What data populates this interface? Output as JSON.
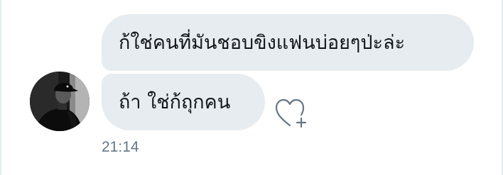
{
  "messages": [
    {
      "text": "ก้ใช่คนที่มันชอบขิงแฟนบ่อยๆป่ะล่ะ"
    },
    {
      "text": "ถ้า ใช่ก้ถุกคน"
    }
  ],
  "timestamp": "21:14",
  "colors": {
    "bubble_background": "#e6ecf0",
    "text": "#14171a",
    "secondary_text": "#657786"
  },
  "icons": {
    "like": "heart-plus-icon",
    "avatar": "user-avatar"
  }
}
